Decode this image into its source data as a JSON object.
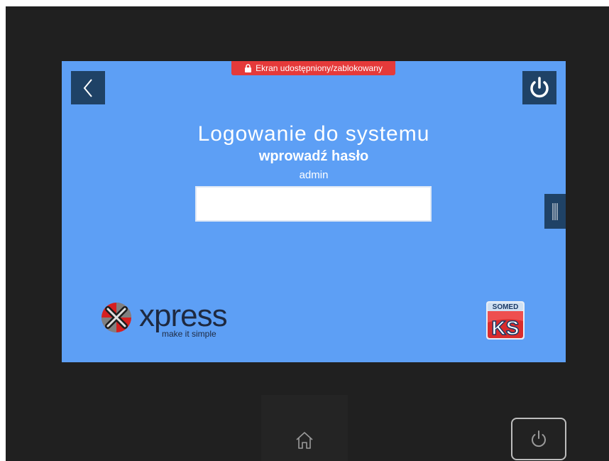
{
  "lock_banner": {
    "text": "Ekran udostępniony/zablokowany",
    "icon": "lock-icon",
    "color": "#e53a3a"
  },
  "login": {
    "title": "Logowanie do systemu",
    "subtitle": "wprowadź hasło",
    "username": "admin",
    "password_value": ""
  },
  "logos": {
    "xpress": {
      "word": "xpress",
      "tagline": "make it simple"
    },
    "somed": {
      "label": "SOMED",
      "mark": "KS"
    }
  },
  "icons": {
    "back": "chevron-left-icon",
    "power_top": "power-icon",
    "side_handle": "drag-handle-icon",
    "home": "home-icon",
    "power_bottom": "power-icon"
  },
  "colors": {
    "screen": "#5d9ff5",
    "button": "#1f4266",
    "device": "#202020",
    "logo_text": "#1e2940"
  }
}
